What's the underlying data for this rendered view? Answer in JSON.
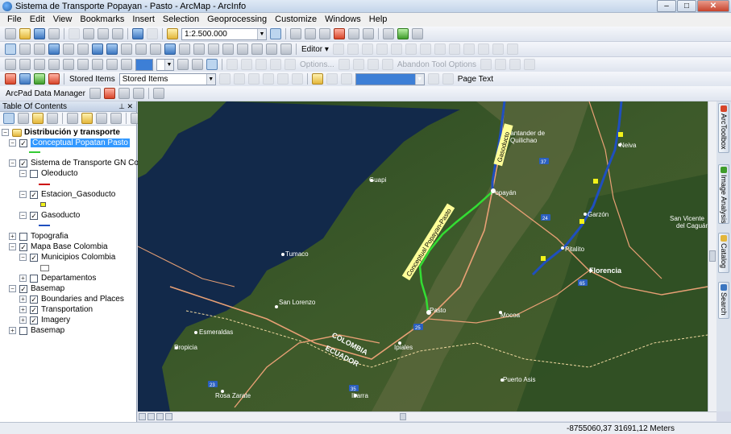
{
  "window": {
    "title": "Sistema de Transporte Popayan - Pasto - ArcMap - ArcInfo"
  },
  "menu": [
    "File",
    "Edit",
    "View",
    "Bookmarks",
    "Insert",
    "Selection",
    "Geoprocessing",
    "Customize",
    "Windows",
    "Help"
  ],
  "toolbar": {
    "scale": "1:2.500.000",
    "editor_label": "Editor ▾",
    "options_label": "Options...",
    "abandon_label": "Abandon Tool Options",
    "stored_items_label": "Stored Items",
    "stored_items_combo": "Stored Items",
    "page_text_label": "Page Text",
    "arcpad_label": "ArcPad Data Manager"
  },
  "toc": {
    "header": "Table Of Contents",
    "dataframe": "Distribución y transporte",
    "layers": {
      "conceptual": "Conceptual Popatan Pasto",
      "gn_group": "Sistema de Transporte GN Colomb",
      "oleoducto": "Oleoducto",
      "estacion": "Estacion_Gasoducto",
      "gasoducto": "Gasoducto",
      "topografia": "Topografia",
      "mapa_base": "Mapa Base Colombia",
      "municipios": "Municipios Colombia",
      "departamentos": "Departamentos",
      "basemap_group": "Basemap",
      "boundaries": "Boundaries and Places",
      "transportation": "Transportation",
      "imagery": "Imagery",
      "basemap_layer": "Basemap"
    },
    "colors": {
      "conceptual": "#33cc33",
      "oleoducto": "#cc0000",
      "gasoducto": "#1f4fbf",
      "estacion": "#f2f21a"
    }
  },
  "map": {
    "places": {
      "guapi": "Guapi",
      "tumaco": "Tumaco",
      "san_lorenzo": "San Lorenzo",
      "esmeraldas": "Esmeraldas",
      "propicia": "Propicia",
      "rosa_zarate": "Rosa Zarate",
      "popayan": "Popayán",
      "pasto": "Pasto",
      "mocoa": "Mocoa",
      "florencia": "Florencia",
      "neiva": "Neiva",
      "garzon": "Garzón",
      "pitalito": "Pitalito",
      "puerto_asis": "Puerto Asis",
      "ipiales": "Ipiales",
      "ibarra": "Ibarra",
      "santander": "Santander de",
      "quilichao": "Quilichao",
      "san_vicente": "San Vicente",
      "del_caguan": "del Caguán",
      "colombia": "COLOMBIA",
      "ecuador": "ECUADOR",
      "route_label": "Conceptual Popayan-Pasto",
      "gn_label": "Gasoducto"
    },
    "shields": [
      "25",
      "24",
      "65",
      "45",
      "25",
      "37",
      "23",
      "23",
      "35"
    ]
  },
  "dock_tabs": [
    "ArcToolbox",
    "Image Analysis",
    "Catalog",
    "Search"
  ],
  "status": {
    "coordinates": "-8755060,37  31691,12 Meters"
  }
}
